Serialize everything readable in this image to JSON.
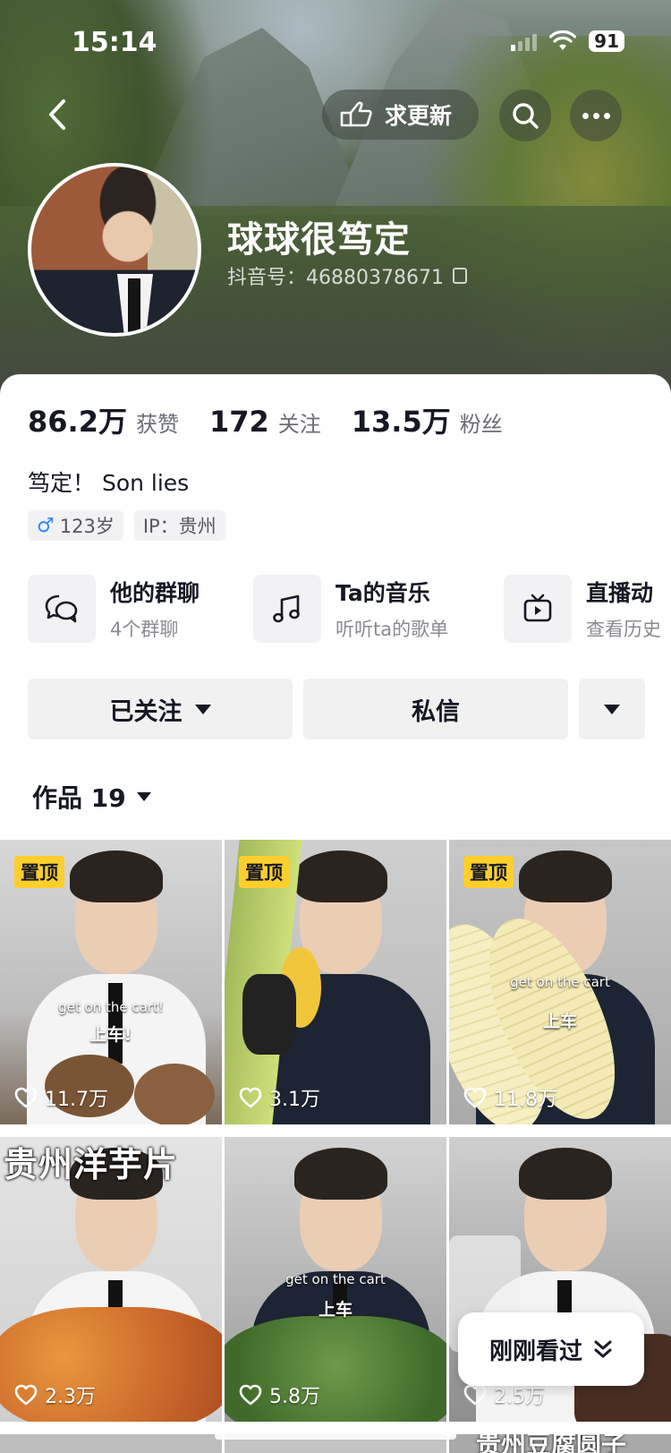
{
  "status_bar": {
    "time": "15:14",
    "battery": "91"
  },
  "header": {
    "update_label": "求更新"
  },
  "profile": {
    "nickname": "球球很笃定",
    "douyin_id": "抖音号：46880378671",
    "stats": [
      {
        "num": "86.2万",
        "label": "获赞"
      },
      {
        "num": "172",
        "label": "关注"
      },
      {
        "num": "13.5万",
        "label": "粉丝"
      }
    ],
    "bio": "笃定！ Son lies",
    "tags": {
      "gender_symbol": "♂",
      "age": "123岁",
      "ip": "IP：贵州"
    }
  },
  "features": [
    {
      "title": "他的群聊",
      "sub": "4个群聊"
    },
    {
      "title": "Ta的音乐",
      "sub": "听听ta的歌单"
    },
    {
      "title": "直播动",
      "sub": "查看历史"
    }
  ],
  "actions": {
    "follow": "已关注",
    "message": "私信"
  },
  "works_tab": {
    "label": "作品 19"
  },
  "videos": [
    {
      "pinned": "置顶",
      "likes": "11.7万",
      "sub_en": "get on the cart!",
      "sub_zh": "上车!"
    },
    {
      "pinned": "置顶",
      "likes": "3.1万"
    },
    {
      "pinned": "置顶",
      "likes": "11.8万",
      "sub_en": "get on the cart",
      "sub_zh": "上车"
    },
    {
      "title": "贵州洋芋片",
      "likes": "2.3万"
    },
    {
      "likes": "5.8万",
      "sub_en": "get on the cart",
      "sub_zh": "上车"
    },
    {
      "likes": "2.5万"
    }
  ],
  "next_row_title": "贵州豆腐圆子",
  "recent_chip": "刚刚看过",
  "colors": {
    "pin_badge": "#fccf2d",
    "button_bg": "#f1f1f2",
    "text_primary": "#161823",
    "text_secondary": "#6b6d74"
  }
}
